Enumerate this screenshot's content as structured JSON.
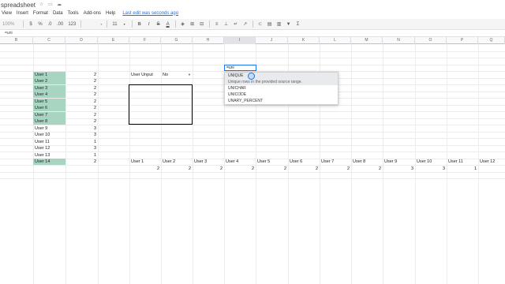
{
  "app": {
    "title": "spreadsheet",
    "title_icons": [
      "star-icon",
      "folder-icon",
      "cloud-icon"
    ],
    "menu": [
      "View",
      "Insert",
      "Format",
      "Data",
      "Tools",
      "Add-ons",
      "Help"
    ],
    "last_edit": "Last edit was seconds ago"
  },
  "toolbar": {
    "zoom": "100%",
    "currency": "$",
    "percent": "%",
    "dec_decrease": ".0",
    "dec_increase": ".00",
    "more_formats": "123",
    "font_size": "11",
    "bold": "B",
    "italic": "I",
    "strike": "S",
    "text_color": "A"
  },
  "formula_bar": {
    "content": "=uni"
  },
  "columns": [
    "B",
    "C",
    "D",
    "E",
    "F",
    "G",
    "H",
    "I",
    "J",
    "K",
    "L",
    "M",
    "N",
    "O",
    "P",
    "Q"
  ],
  "active_column": "I",
  "users_list": [
    {
      "name": "User 1",
      "value": "2",
      "highlight": true
    },
    {
      "name": "User 2",
      "value": "2",
      "highlight": true
    },
    {
      "name": "User 3",
      "value": "2",
      "highlight": true
    },
    {
      "name": "User 4",
      "value": "2",
      "highlight": true
    },
    {
      "name": "User 5",
      "value": "2",
      "highlight": true
    },
    {
      "name": "User 6",
      "value": "2",
      "highlight": true
    },
    {
      "name": "User 7",
      "value": "2",
      "highlight": true
    },
    {
      "name": "User 8",
      "value": "2",
      "highlight": true
    },
    {
      "name": "User 9",
      "value": "3",
      "highlight": false
    },
    {
      "name": "User 10",
      "value": "3",
      "highlight": false
    },
    {
      "name": "User 11",
      "value": "1",
      "highlight": false
    },
    {
      "name": "User 12",
      "value": "3",
      "highlight": false
    },
    {
      "name": "User 13",
      "value": "1",
      "highlight": false
    },
    {
      "name": "User 14",
      "value": "2",
      "highlight": true
    }
  ],
  "user_input": {
    "label": "User Unput",
    "value": "No"
  },
  "active_cell": {
    "value": "=uni"
  },
  "autocomplete": {
    "items": [
      {
        "name": "UNIQUE",
        "selected": true
      },
      {
        "name": "UNICHAR",
        "selected": false
      },
      {
        "name": "UNICODE",
        "selected": false
      },
      {
        "name": "UNARY_PERCENT",
        "selected": false
      }
    ],
    "description": "Unique rows in the provided source range."
  },
  "horizontal_users": [
    {
      "name": "User 1",
      "value": "2"
    },
    {
      "name": "User 2",
      "value": "2"
    },
    {
      "name": "User 3",
      "value": "2"
    },
    {
      "name": "User 4",
      "value": "2"
    },
    {
      "name": "User 5",
      "value": "2"
    },
    {
      "name": "User 6",
      "value": "2"
    },
    {
      "name": "User 7",
      "value": "2"
    },
    {
      "name": "User 8",
      "value": "2"
    },
    {
      "name": "User 9",
      "value": "3"
    },
    {
      "name": "User 10",
      "value": "3"
    },
    {
      "name": "User 11",
      "value": "1"
    },
    {
      "name": "User 12",
      "value": ""
    }
  ],
  "colors": {
    "highlight": "#a8d5c2",
    "accent": "#1a73e8"
  }
}
